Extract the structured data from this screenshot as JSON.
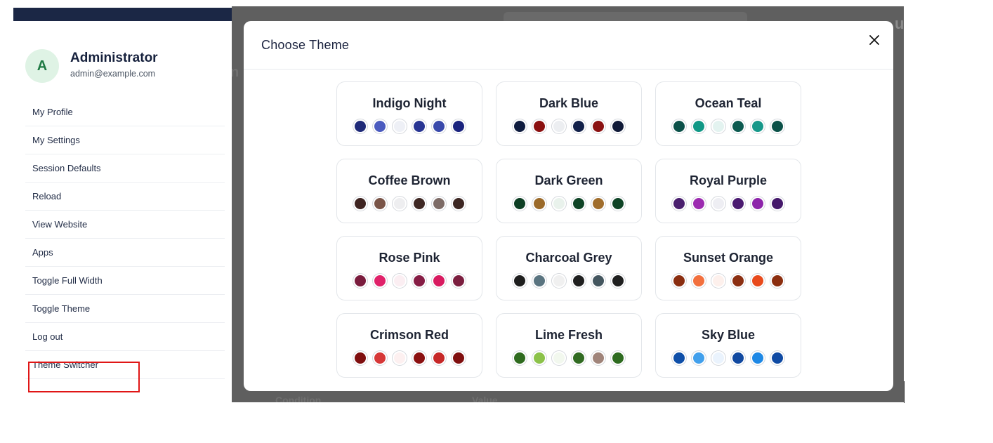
{
  "user": {
    "avatar_initial": "A",
    "name": "Administrator",
    "email": "admin@example.com"
  },
  "menu": [
    {
      "label": "My Profile"
    },
    {
      "label": "My Settings"
    },
    {
      "label": "Session Defaults"
    },
    {
      "label": "Reload"
    },
    {
      "label": "View Website"
    },
    {
      "label": "Apps"
    },
    {
      "label": "Toggle Full Width"
    },
    {
      "label": "Toggle Theme"
    },
    {
      "label": "Log out"
    },
    {
      "label": "Theme Switcher",
      "highlighted": true
    }
  ],
  "modal": {
    "title": "Choose Theme",
    "close_icon": "close-icon"
  },
  "background_fragments": {
    "left_letter": "n",
    "right_letter": "u",
    "bottom_left": "Condition",
    "bottom_right": "Value"
  },
  "themes": [
    {
      "name": "Indigo Night",
      "colors": [
        "#1f2a78",
        "#4b5bbf",
        "#eef0f6",
        "#283593",
        "#3949ab",
        "#1a237e"
      ]
    },
    {
      "name": "Dark Blue",
      "colors": [
        "#0f1c3f",
        "#8b1010",
        "#eceef1",
        "#13214a",
        "#8b1212",
        "#101a38"
      ]
    },
    {
      "name": "Ocean Teal",
      "colors": [
        "#0b5149",
        "#109886",
        "#e3f3f0",
        "#0c5a50",
        "#17988a",
        "#0b5148"
      ]
    },
    {
      "name": "Coffee Brown",
      "colors": [
        "#3e2421",
        "#7a5548",
        "#eeeef0",
        "#3e2723",
        "#7d6b66",
        "#3c2622"
      ]
    },
    {
      "name": "Dark Green",
      "colors": [
        "#0d3f24",
        "#9b6a2a",
        "#e9f2ec",
        "#0f4426",
        "#a06d2c",
        "#0f4426"
      ]
    },
    {
      "name": "Royal Purple",
      "colors": [
        "#4a1f6e",
        "#9c2bb0",
        "#eeeef3",
        "#4a1a70",
        "#8d24aa",
        "#44186a"
      ]
    },
    {
      "name": "Rose Pink",
      "colors": [
        "#7a1c3d",
        "#e0226a",
        "#fbeef2",
        "#861d45",
        "#d81b60",
        "#7b1e3f"
      ]
    },
    {
      "name": "Charcoal Grey",
      "colors": [
        "#1e1e1e",
        "#5a7480",
        "#f0f0f0",
        "#1f1f1f",
        "#44565f",
        "#1f1f1f"
      ]
    },
    {
      "name": "Sunset Orange",
      "colors": [
        "#8a2e10",
        "#f2703e",
        "#fdf0ec",
        "#8b2f12",
        "#e84a1c",
        "#8b2e0f"
      ]
    },
    {
      "name": "Crimson Red",
      "colors": [
        "#7f0f0f",
        "#d63838",
        "#fdf0f0",
        "#8b1111",
        "#c62828",
        "#7f0f0f"
      ]
    },
    {
      "name": "Lime Fresh",
      "colors": [
        "#2f6b1f",
        "#8cc24a",
        "#f2f8ee",
        "#316b22",
        "#a0847a",
        "#2e6b20"
      ]
    },
    {
      "name": "Sky Blue",
      "colors": [
        "#0f4fa8",
        "#42a0ec",
        "#eaf3fd",
        "#1149a0",
        "#1e88e5",
        "#0f4aa3"
      ]
    }
  ]
}
